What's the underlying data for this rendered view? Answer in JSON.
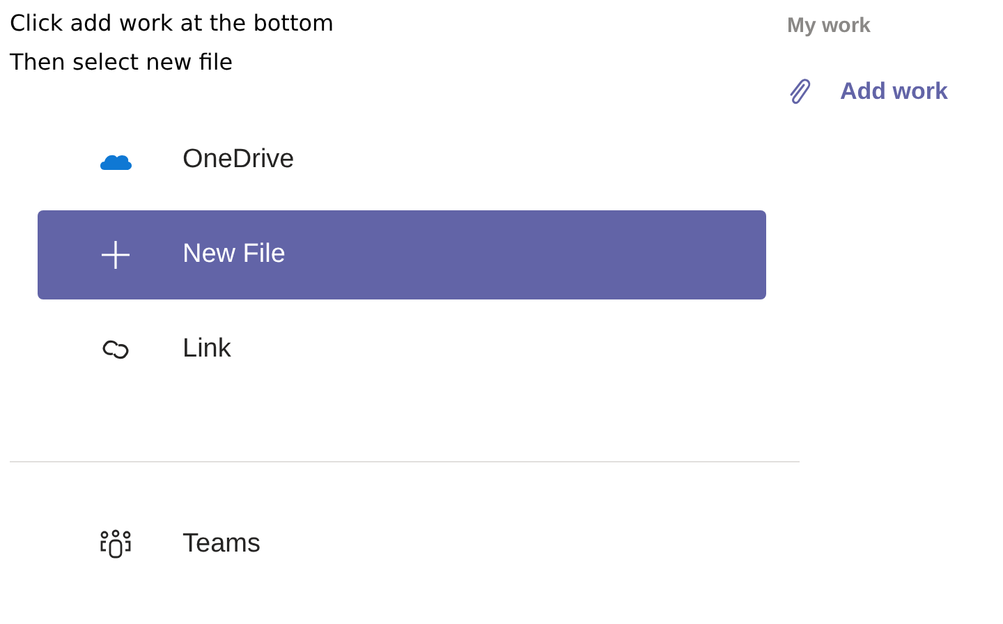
{
  "instructions": [
    "Click add work at the bottom",
    "Then select new file"
  ],
  "my_work": {
    "title": "My work",
    "add_button": {
      "label": "Add work"
    }
  },
  "menu": {
    "groups": [
      [
        {
          "kind": "cloud",
          "label": "OneDrive",
          "selected": false
        },
        {
          "kind": "plus",
          "label": "New File",
          "selected": true
        },
        {
          "kind": "link",
          "label": "Link",
          "selected": false
        }
      ],
      [
        {
          "kind": "teams",
          "label": "Teams",
          "selected": false
        }
      ]
    ]
  }
}
